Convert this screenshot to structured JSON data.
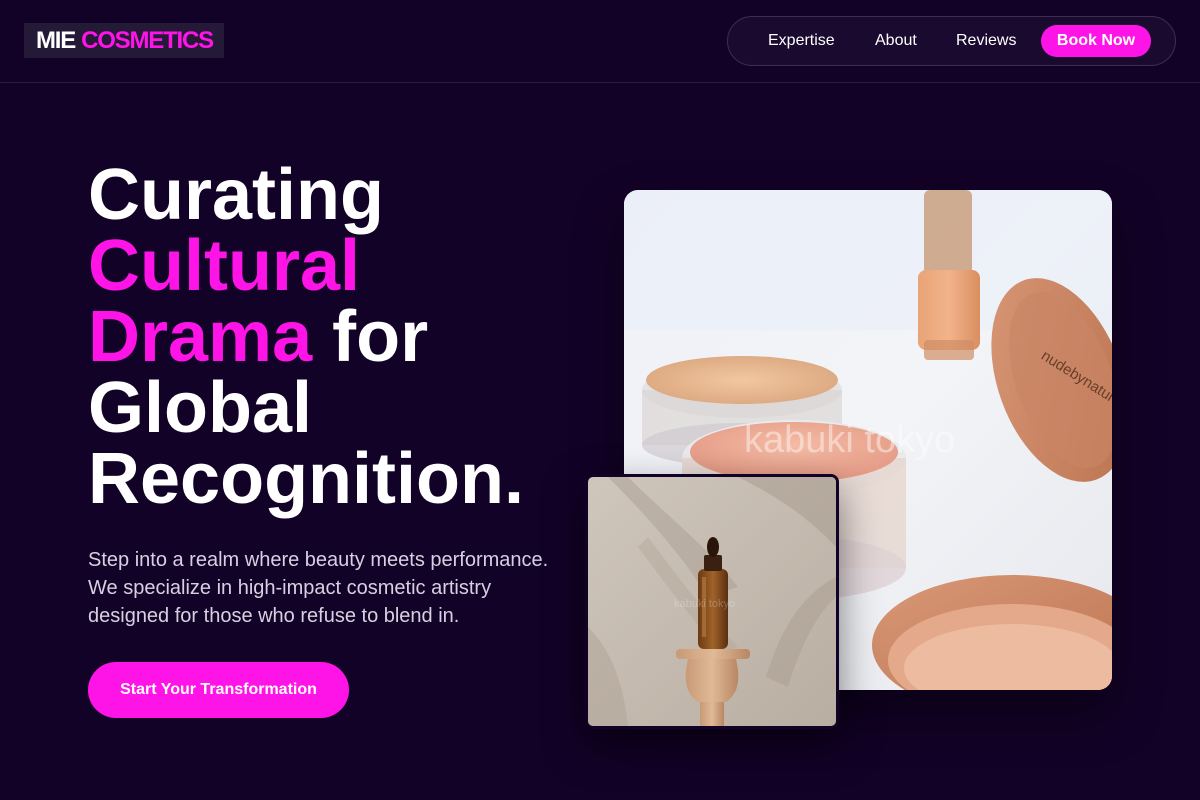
{
  "brand": {
    "name_part1": "MIE",
    "name_part2": "COSMETICS"
  },
  "nav": {
    "links": [
      "Expertise",
      "About",
      "Reviews"
    ],
    "book_label": "Book Now"
  },
  "hero": {
    "headline_line1": "Curating",
    "headline_accent1": "Cultural",
    "headline_accent2": "Drama",
    "headline_rest2": "for",
    "headline_line4": "Global",
    "headline_line5": "Recognition.",
    "description": "Step into a realm where beauty meets performance. We specialize in high-impact cosmetic artistry designed for those who refuse to blend in.",
    "cta_label": "Start Your Transformation"
  },
  "images": {
    "main_label": "nudebynature",
    "watermark": "kabuki tokyo"
  },
  "colors": {
    "background": "#130227",
    "accent": "#ff14e8",
    "text": "#ffffff"
  }
}
